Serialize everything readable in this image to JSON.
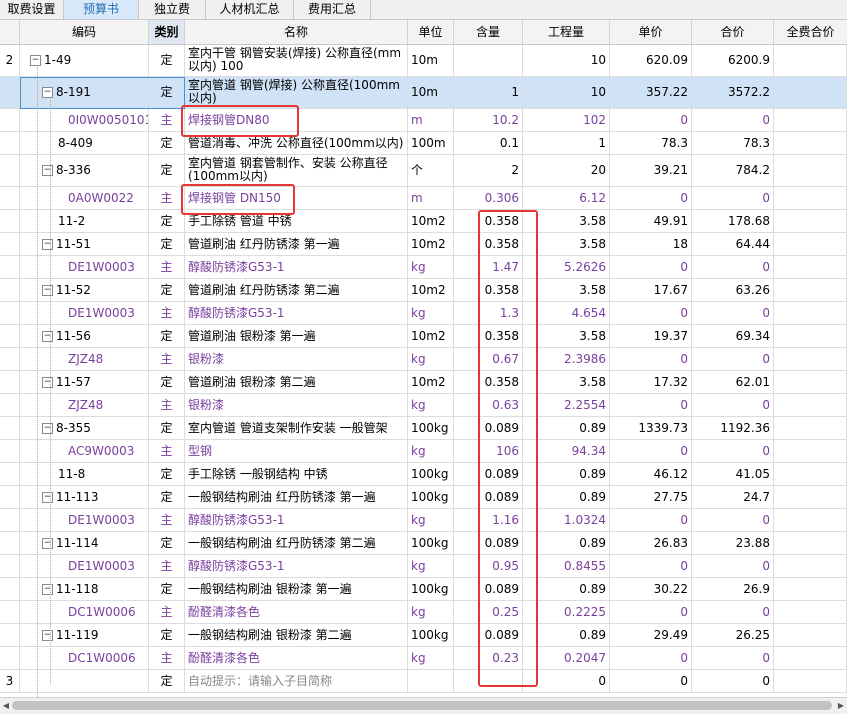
{
  "tabs": [
    {
      "label": "取费设置",
      "active": false
    },
    {
      "label": "预算书",
      "active": true
    },
    {
      "label": "独立费",
      "active": false
    },
    {
      "label": "人材机汇总",
      "active": false
    },
    {
      "label": "费用汇总",
      "active": false
    }
  ],
  "columns": {
    "code": "编码",
    "type": "类别",
    "name": "名称",
    "unit": "单位",
    "content": "含量",
    "qty": "工程量",
    "price": "单价",
    "total": "合价",
    "total_full": "全费合价"
  },
  "rows": [
    {
      "no": "2",
      "code": "1-49",
      "type": "定",
      "name": "室内干管 钢管安装(焊接) 公称直径(mm以内) 100",
      "unit": "10m",
      "content": "",
      "qty": "10",
      "price": "620.09",
      "total": "6200.9",
      "kind": "parent",
      "level": 0,
      "expander": "−"
    },
    {
      "no": "",
      "code": "8-191",
      "type": "定",
      "name": "室内管道 钢管(焊接) 公称直径(100mm以内)",
      "unit": "10m",
      "content": "1",
      "qty": "10",
      "price": "357.22",
      "total": "3572.2",
      "kind": "item",
      "level": 1,
      "expander": "−",
      "selected": true
    },
    {
      "no": "",
      "code": "0I0W0050101",
      "type": "主",
      "name": "焊接钢管DN80",
      "unit": "m",
      "content": "10.2",
      "qty": "102",
      "price": "0",
      "total": "0",
      "kind": "sub",
      "level": 2
    },
    {
      "no": "",
      "code": "8-409",
      "type": "定",
      "name": "管道消毒、冲洗 公称直径(100mm以内)",
      "unit": "100m",
      "content": "0.1",
      "qty": "1",
      "price": "78.3",
      "total": "78.3",
      "kind": "item",
      "level": 1
    },
    {
      "no": "",
      "code": "8-336",
      "type": "定",
      "name": "室内管道 钢套管制作、安装 公称直径(100mm以内)",
      "unit": "个",
      "content": "2",
      "qty": "20",
      "price": "39.21",
      "total": "784.2",
      "kind": "item",
      "level": 1,
      "expander": "−"
    },
    {
      "no": "",
      "code": "0A0W0022",
      "type": "主",
      "name": "焊接钢管 DN150",
      "unit": "m",
      "content": "0.306",
      "qty": "6.12",
      "price": "0",
      "total": "0",
      "kind": "sub",
      "level": 2
    },
    {
      "no": "",
      "code": "11-2",
      "type": "定",
      "name": "手工除锈 管道 中锈",
      "unit": "10m2",
      "content": "0.358",
      "qty": "3.58",
      "price": "49.91",
      "total": "178.68",
      "kind": "item",
      "level": 1
    },
    {
      "no": "",
      "code": "11-51",
      "type": "定",
      "name": "管道刷油 红丹防锈漆 第一遍",
      "unit": "10m2",
      "content": "0.358",
      "qty": "3.58",
      "price": "18",
      "total": "64.44",
      "kind": "item",
      "level": 1,
      "expander": "−"
    },
    {
      "no": "",
      "code": "DE1W0003",
      "type": "主",
      "name": "醇酸防锈漆G53-1",
      "unit": "kg",
      "content": "1.47",
      "qty": "5.2626",
      "price": "0",
      "total": "0",
      "kind": "sub",
      "level": 2
    },
    {
      "no": "",
      "code": "11-52",
      "type": "定",
      "name": "管道刷油 红丹防锈漆 第二遍",
      "unit": "10m2",
      "content": "0.358",
      "qty": "3.58",
      "price": "17.67",
      "total": "63.26",
      "kind": "item",
      "level": 1,
      "expander": "−"
    },
    {
      "no": "",
      "code": "DE1W0003",
      "type": "主",
      "name": "醇酸防锈漆G53-1",
      "unit": "kg",
      "content": "1.3",
      "qty": "4.654",
      "price": "0",
      "total": "0",
      "kind": "sub",
      "level": 2
    },
    {
      "no": "",
      "code": "11-56",
      "type": "定",
      "name": "管道刷油 银粉漆 第一遍",
      "unit": "10m2",
      "content": "0.358",
      "qty": "3.58",
      "price": "19.37",
      "total": "69.34",
      "kind": "item",
      "level": 1,
      "expander": "−"
    },
    {
      "no": "",
      "code": "ZJZ48",
      "type": "主",
      "name": "银粉漆",
      "unit": "kg",
      "content": "0.67",
      "qty": "2.3986",
      "price": "0",
      "total": "0",
      "kind": "sub",
      "level": 2
    },
    {
      "no": "",
      "code": "11-57",
      "type": "定",
      "name": "管道刷油 银粉漆 第二遍",
      "unit": "10m2",
      "content": "0.358",
      "qty": "3.58",
      "price": "17.32",
      "total": "62.01",
      "kind": "item",
      "level": 1,
      "expander": "−"
    },
    {
      "no": "",
      "code": "ZJZ48",
      "type": "主",
      "name": "银粉漆",
      "unit": "kg",
      "content": "0.63",
      "qty": "2.2554",
      "price": "0",
      "total": "0",
      "kind": "sub",
      "level": 2
    },
    {
      "no": "",
      "code": "8-355",
      "type": "定",
      "name": "室内管道 管道支架制作安装 一般管架",
      "unit": "100kg",
      "content": "0.089",
      "qty": "0.89",
      "price": "1339.73",
      "total": "1192.36",
      "kind": "item",
      "level": 1,
      "expander": "−"
    },
    {
      "no": "",
      "code": "AC9W0003",
      "type": "主",
      "name": "型钢",
      "unit": "kg",
      "content": "106",
      "qty": "94.34",
      "price": "0",
      "total": "0",
      "kind": "sub",
      "level": 2
    },
    {
      "no": "",
      "code": "11-8",
      "type": "定",
      "name": "手工除锈 一般钢结构 中锈",
      "unit": "100kg",
      "content": "0.089",
      "qty": "0.89",
      "price": "46.12",
      "total": "41.05",
      "kind": "item",
      "level": 1
    },
    {
      "no": "",
      "code": "11-113",
      "type": "定",
      "name": "一般钢结构刷油 红丹防锈漆 第一遍",
      "unit": "100kg",
      "content": "0.089",
      "qty": "0.89",
      "price": "27.75",
      "total": "24.7",
      "kind": "item",
      "level": 1,
      "expander": "−"
    },
    {
      "no": "",
      "code": "DE1W0003",
      "type": "主",
      "name": "醇酸防锈漆G53-1",
      "unit": "kg",
      "content": "1.16",
      "qty": "1.0324",
      "price": "0",
      "total": "0",
      "kind": "sub",
      "level": 2
    },
    {
      "no": "",
      "code": "11-114",
      "type": "定",
      "name": "一般钢结构刷油 红丹防锈漆 第二遍",
      "unit": "100kg",
      "content": "0.089",
      "qty": "0.89",
      "price": "26.83",
      "total": "23.88",
      "kind": "item",
      "level": 1,
      "expander": "−"
    },
    {
      "no": "",
      "code": "DE1W0003",
      "type": "主",
      "name": "醇酸防锈漆G53-1",
      "unit": "kg",
      "content": "0.95",
      "qty": "0.8455",
      "price": "0",
      "total": "0",
      "kind": "sub",
      "level": 2
    },
    {
      "no": "",
      "code": "11-118",
      "type": "定",
      "name": "一般钢结构刷油 银粉漆 第一遍",
      "unit": "100kg",
      "content": "0.089",
      "qty": "0.89",
      "price": "30.22",
      "total": "26.9",
      "kind": "item",
      "level": 1,
      "expander": "−"
    },
    {
      "no": "",
      "code": "DC1W0006",
      "type": "主",
      "name": "酚醛清漆各色",
      "unit": "kg",
      "content": "0.25",
      "qty": "0.2225",
      "price": "0",
      "total": "0",
      "kind": "sub",
      "level": 2
    },
    {
      "no": "",
      "code": "11-119",
      "type": "定",
      "name": "一般钢结构刷油 银粉漆 第二遍",
      "unit": "100kg",
      "content": "0.089",
      "qty": "0.89",
      "price": "29.49",
      "total": "26.25",
      "kind": "item",
      "level": 1,
      "expander": "−"
    },
    {
      "no": "",
      "code": "DC1W0006",
      "type": "主",
      "name": "酚醛清漆各色",
      "unit": "kg",
      "content": "0.23",
      "qty": "0.2047",
      "price": "0",
      "total": "0",
      "kind": "sub",
      "level": 2
    },
    {
      "no": "3",
      "code": "",
      "type": "定",
      "name": "自动提示：请输入子目简称",
      "unit": "",
      "content": "",
      "qty": "0",
      "price": "0",
      "total": "0",
      "kind": "auto",
      "level": 0
    }
  ],
  "colors": {
    "selected_row": "#cfe2f6",
    "sub_text": "#7b3f9e",
    "highlight_box": "#e53535",
    "active_tab": "#2a6fb5"
  }
}
